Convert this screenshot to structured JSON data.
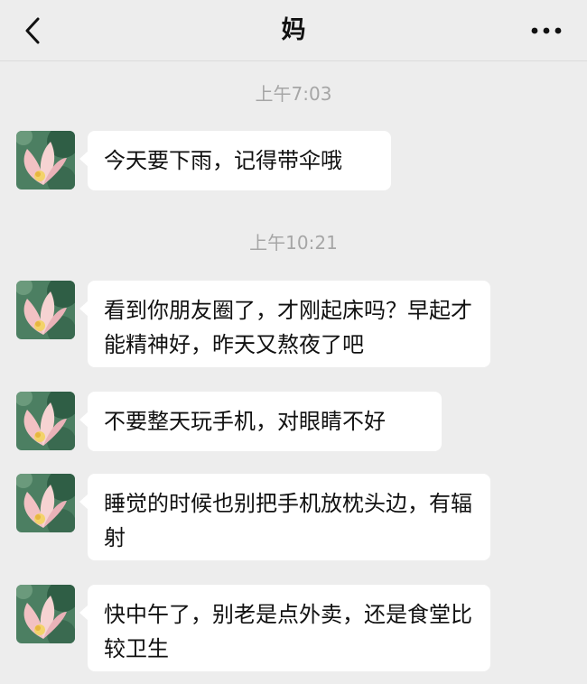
{
  "header": {
    "back_icon": "chevron-left-icon",
    "title": "妈",
    "more_icon": "more-horizontal-icon"
  },
  "chat": {
    "timestamps": [
      "上午7:03",
      "上午10:21"
    ],
    "messages": [
      {
        "sender": "妈",
        "text": "今天要下雨，记得带伞哦"
      },
      {
        "sender": "妈",
        "text": "看到你朋友圈了，才刚起床吗？早起才能精神好，昨天又熬夜了吧"
      },
      {
        "sender": "妈",
        "text": "不要整天玩手机，对眼睛不好"
      },
      {
        "sender": "妈",
        "text": "睡觉的时候也别把手机放枕头边，有辐射"
      },
      {
        "sender": "妈",
        "text": "快中午了，别老是点外卖，还是食堂比较卫生"
      }
    ]
  },
  "colors": {
    "background": "#ededed",
    "bubble": "#ffffff",
    "timestamp": "#a6a6a6"
  }
}
